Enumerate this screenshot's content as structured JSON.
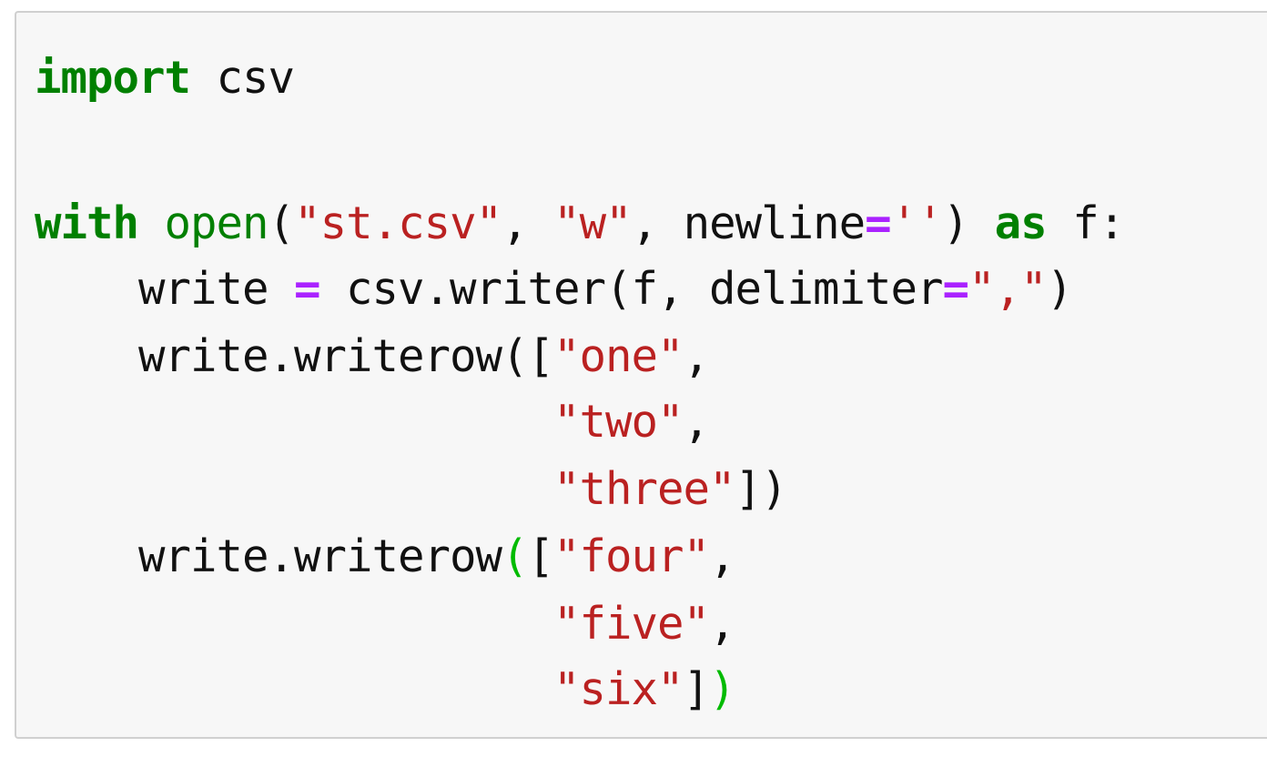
{
  "code_cell": {
    "language": "python",
    "lines": [
      {
        "tokens": [
          {
            "type": "kw",
            "text": "import"
          },
          {
            "type": "name",
            "text": " csv"
          }
        ]
      },
      {
        "tokens": []
      },
      {
        "tokens": [
          {
            "type": "kw",
            "text": "with"
          },
          {
            "type": "name",
            "text": " "
          },
          {
            "type": "builtin",
            "text": "open"
          },
          {
            "type": "punc",
            "text": "("
          },
          {
            "type": "str",
            "text": "\"st.csv\""
          },
          {
            "type": "punc",
            "text": ", "
          },
          {
            "type": "str",
            "text": "\"w\""
          },
          {
            "type": "punc",
            "text": ", newline"
          },
          {
            "type": "op",
            "text": "="
          },
          {
            "type": "str",
            "text": "''"
          },
          {
            "type": "punc",
            "text": ") "
          },
          {
            "type": "kw",
            "text": "as"
          },
          {
            "type": "name",
            "text": " f:"
          }
        ]
      },
      {
        "tokens": [
          {
            "type": "name",
            "text": "    write "
          },
          {
            "type": "op",
            "text": "="
          },
          {
            "type": "name",
            "text": " csv.writer(f, delimiter"
          },
          {
            "type": "op",
            "text": "="
          },
          {
            "type": "str",
            "text": "\",\""
          },
          {
            "type": "punc",
            "text": ")"
          }
        ]
      },
      {
        "tokens": [
          {
            "type": "name",
            "text": "    write.writerow(["
          },
          {
            "type": "str",
            "text": "\"one\""
          },
          {
            "type": "punc",
            "text": ","
          }
        ]
      },
      {
        "tokens": [
          {
            "type": "name",
            "text": "                    "
          },
          {
            "type": "str",
            "text": "\"two\""
          },
          {
            "type": "punc",
            "text": ","
          }
        ]
      },
      {
        "tokens": [
          {
            "type": "name",
            "text": "                    "
          },
          {
            "type": "str",
            "text": "\"three\""
          },
          {
            "type": "punc",
            "text": "])"
          }
        ]
      },
      {
        "tokens": [
          {
            "type": "name",
            "text": "    write.writerow"
          },
          {
            "type": "bracket-hl",
            "text": "("
          },
          {
            "type": "punc",
            "text": "["
          },
          {
            "type": "str",
            "text": "\"four\""
          },
          {
            "type": "punc",
            "text": ","
          }
        ]
      },
      {
        "tokens": [
          {
            "type": "name",
            "text": "                    "
          },
          {
            "type": "str",
            "text": "\"five\""
          },
          {
            "type": "punc",
            "text": ","
          }
        ]
      },
      {
        "tokens": [
          {
            "type": "name",
            "text": "                    "
          },
          {
            "type": "str",
            "text": "\"six\""
          },
          {
            "type": "punc",
            "text": "]"
          },
          {
            "type": "bracket-hl",
            "text": ")"
          }
        ]
      }
    ]
  },
  "colors": {
    "keyword": "#008000",
    "string": "#ba2121",
    "operator": "#aa22ff",
    "bracket_highlight": "#00bb00",
    "text": "#111111",
    "cell_background": "#f7f7f7",
    "cell_border": "#d0d0d0"
  }
}
